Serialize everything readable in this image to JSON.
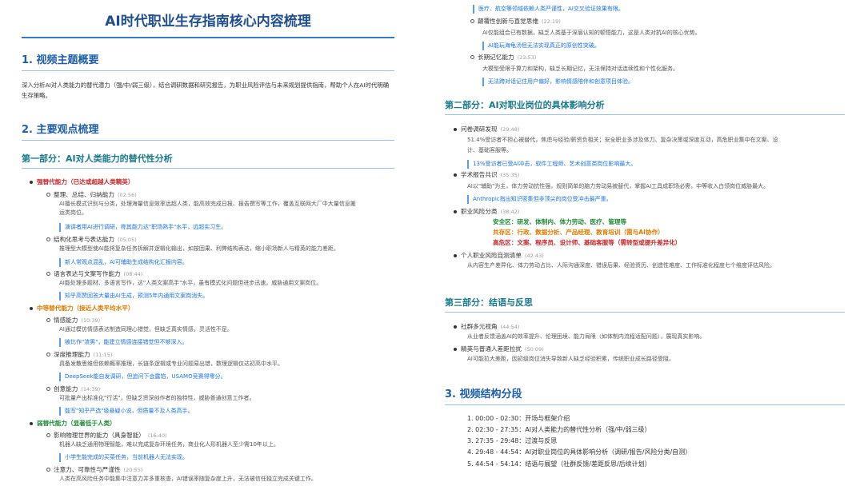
{
  "doc": {
    "title": "AI时代职业生存指南核心内容梳理",
    "sec1_heading": "1. 视频主题概要",
    "summary": "深入分析AI对人类能力的替代潜力（强/中/弱三级），结合调研数据和研究报告，为职业风险评估与未来规划提供指南，帮助个人在AI时代明确生存策略。",
    "sec2_heading": "2. 主要观点梳理",
    "part1_heading": "第一部分：AI对人类能力的替代性分析",
    "strong": {
      "label": "强替代能力（已达或超越人类精英）",
      "items": [
        {
          "name": "整理、总结、归纳能力",
          "time": "(02:56)",
          "desc": [
            "AI擅长模式识别与分类，处理海量信息效率远超人类，能高效完成日报、报告撰写等工作，覆盖互联网大厂中大量信息搬",
            "运类岗位。"
          ],
          "quote": "演讲者用AI进行调研，称其能力达\"职场熟手\"水平，远超实习生。"
        },
        {
          "name": "结构化思考与表达能力",
          "time": "(05:05)",
          "desc": [
            "推理型大模型使AI能将复杂任务拆解并逻辑化输出，如按因果、利弊结构表达，缩小职场新人与精英的能力差距。"
          ],
          "quote": "新人常观点混乱，AI可辅助生成结构化汇报内容。"
        },
        {
          "name": "语言表达与文案写作能力",
          "time": "(08:44)",
          "desc": [
            "AI能处理多题材、多语言写作，达\"人类文案高手\"水平，虽有模式化问题但进步迅速，威胁通用文案岗位。"
          ],
          "quote": "知乎高赞回答大量由AI生成，预测5年内通用文案岗消失。"
        }
      ]
    },
    "medium": {
      "label": "中等替代能力（接近人类平均水平）",
      "items": [
        {
          "name": "情感能力",
          "time": "(10:39)",
          "desc": [
            "AI通过模仿情感表达制造同理心错觉，但缺乏真实情感，灵活性不足。"
          ],
          "quote": "被比作\"渣男\"，能建立情感连接错觉但不够深入。"
        },
        {
          "name": "深度推理能力",
          "time": "(11:15)",
          "desc": [
            "具备发散思维但依赖概率推理，长链条逻辑或专业问题易出错，数理逻辑仅达初高中水平。"
          ],
          "quote": "DeepSeek能自发调研，但追问下会露馅，USAMO竞赛得零分。"
        },
        {
          "name": "创意能力",
          "time": "(14:39)",
          "desc": [
            "可批量产出标准化\"行活\"，但缺乏资深创作者的独特性，威胁普通创意工作者。"
          ],
          "quote": "能写\"知乎严选\"级悬疑小说，但质量不及人类高手。"
        }
      ]
    },
    "weak": {
      "label": "弱替代能力（显著低于人类）",
      "items": [
        {
          "name": "影响物理世界的能力（具身智能）",
          "time": "(16:40)",
          "desc": [
            "机器人缺乏通用物理智能，难以完成复杂环境任务，商业化人形机器人至少需10年以上。"
          ],
          "quote": "小学生能完成的买菜任务，当前机器人无法实现。"
        },
        {
          "name": "注意力、可靠性与严谨性",
          "time": "(20:55)",
          "desc": [
            "人类在高风险任务中能集中注意力并多重核查，AI错误率随复杂度上升，无法被信任独立完成关键工作。"
          ],
          "quote": "医疗、航空等领域依赖人类严谨性，AI交叉验证效果有限。"
        },
        {
          "name": "颠覆性创新与直觉思维",
          "time": "(22:19)",
          "desc": [
            "AI仅能组合已有数据，缺乏人类基于深层认知的顿悟能力，这是人类对抗AI的核心优势。"
          ],
          "quote": "AI能玩海龟汤但无法实现真正的原创性突破。"
        },
        {
          "name": "长期记忆能力",
          "time": "(23:53)",
          "desc": [
            "大模型受限于算力和架构，缺乏长期记忆，无法保持对话连续性和个性化服务。"
          ],
          "quote": "无法跨对话记住用户偏好，影响情感陪伴和创意项目体验。"
        }
      ]
    },
    "part2_heading": "第二部分：AI对职业岗位的具体影响分析",
    "part2": {
      "survey": {
        "name": "问卷调研发现",
        "time": "(29:48)",
        "desc": [
          "51.4%受访者不担心被替代，焦虑与经验/薪资负相关；安全职业多涉及体力、复杂决策或深度互动，高危职业集中在文案、设",
          "计、基础客服等。"
        ],
        "quote": "13%受访者已受AI冲击，软件工程师、艺术创意类岗位影响最大。"
      },
      "report": {
        "name": "学术报告共识",
        "time": "(35:35)",
        "desc": [
          "AI以\"辅助\"为主，体力劳动抗性强，规则简单的脑力劳动易被替代，掌握AI工具成职场必需，中等收入白领岗位威胁最大。"
        ],
        "quote": "Anthropic指出知识密集但非顶尖的岗位受冲击最严重。"
      },
      "risk": {
        "name": "职业风险分类",
        "time": "(38:42)",
        "safe": "安全区：研发、体制内、体力劳动、医疗、管理等",
        "coexist": "共存区：行政、数据分析、产品经理、教育培训（需与AI协作）",
        "danger": "高危区：文案、程序员、设计师、基础客服等（需转型或提升差异化）"
      },
      "self": {
        "name": "个人职业风险自测清单",
        "time": "(42:43)",
        "desc": "从内容生产差异化、体力劳动占比、人际沟通深度、错误后果、经验资历、创造性难度、工作标准化程度七个维度评估风险。"
      }
    },
    "part3_heading": "第三部分：结语与反思",
    "part3": {
      "items": [
        {
          "name": "社群多元视角",
          "time": "(44:54)",
          "desc": "从业者反馈涵盖AI的效率提升、伦理困境、能力局限（如体制内流程适配问题），展现真实影响。"
        },
        {
          "name": "精英与普通人差距拉扰",
          "time": "(50:09)",
          "desc": "AI可能拉大差距，因初级岗位消失导致新人缺乏经验积累，传统职业成长路径受阻。"
        }
      ]
    },
    "sec3_heading": "3. 视频结构分段",
    "steps": [
      "1. 00:00 - 02:30：开场与框架介绍",
      "2. 02:30 - 27:35：AI对人类能力的替代性分析（强/中/弱三级）",
      "3. 27:35 - 29:48：过渡与反思",
      "4. 29:48 - 44:54：AI对职业岗位的具体影响分析（调研/报告/风险分类/自测）",
      "5. 44:54 - 54:14：结语与展望（社群反馈/差距反思/后续计划）"
    ]
  }
}
